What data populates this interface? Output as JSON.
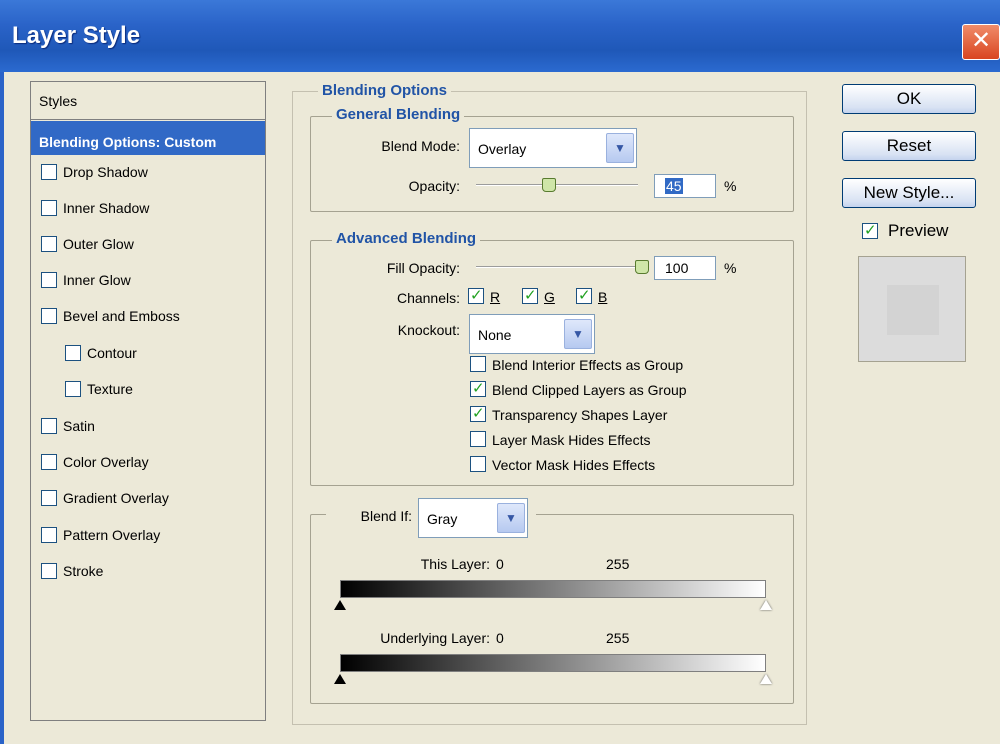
{
  "window": {
    "title": "Layer Style",
    "close_glyph": "✕"
  },
  "styles_panel": {
    "header": "Styles",
    "items": [
      {
        "label": "Blending Options: Custom",
        "selected": true,
        "checkbox": false
      },
      {
        "label": "Drop Shadow",
        "checked": false
      },
      {
        "label": "Inner Shadow",
        "checked": false
      },
      {
        "label": "Outer Glow",
        "checked": false
      },
      {
        "label": "Inner Glow",
        "checked": false
      },
      {
        "label": "Bevel and Emboss",
        "checked": false
      },
      {
        "label": "Contour",
        "checked": false,
        "indent": true
      },
      {
        "label": "Texture",
        "checked": false,
        "indent": true
      },
      {
        "label": "Satin",
        "checked": false
      },
      {
        "label": "Color Overlay",
        "checked": false
      },
      {
        "label": "Gradient Overlay",
        "checked": false
      },
      {
        "label": "Pattern Overlay",
        "checked": false
      },
      {
        "label": "Stroke",
        "checked": false
      }
    ]
  },
  "blending_options": {
    "title": "Blending Options",
    "general": {
      "title": "General Blending",
      "blend_mode_label": "Blend Mode:",
      "blend_mode_value": "Overlay",
      "opacity_label": "Opacity:",
      "opacity_value": "45",
      "opacity_unit": "%",
      "opacity_fraction": 0.45
    },
    "advanced": {
      "title": "Advanced Blending",
      "fill_opacity_label": "Fill Opacity:",
      "fill_opacity_value": "100",
      "fill_opacity_unit": "%",
      "fill_opacity_fraction": 1.0,
      "channels_label": "Channels:",
      "channels": [
        {
          "label": "R",
          "checked": true
        },
        {
          "label": "G",
          "checked": true
        },
        {
          "label": "B",
          "checked": true
        }
      ],
      "knockout_label": "Knockout:",
      "knockout_value": "None",
      "options": [
        {
          "label": "Blend Interior Effects as Group",
          "checked": false
        },
        {
          "label": "Blend Clipped Layers as Group",
          "checked": true
        },
        {
          "label": "Transparency Shapes Layer",
          "checked": true
        },
        {
          "label": "Layer Mask Hides Effects",
          "checked": false
        },
        {
          "label": "Vector Mask Hides Effects",
          "checked": false
        }
      ]
    },
    "blend_if": {
      "label": "Blend If:",
      "value": "Gray",
      "this_layer_label": "This Layer:",
      "this_layer_min": "0",
      "this_layer_max": "255",
      "underlying_label": "Underlying Layer:",
      "underlying_min": "0",
      "underlying_max": "255"
    }
  },
  "buttons": {
    "ok": "OK",
    "reset": "Reset",
    "new_style": "New Style...",
    "preview_label": "Preview",
    "preview_checked": true
  },
  "colors": {
    "title_bar": "#2a63c8",
    "selected_item": "#3169c6",
    "group_title": "#2154a6",
    "dialog_bg": "#ece9d8"
  },
  "icons": {
    "dropdown": "chevron-down-icon",
    "close": "close-icon",
    "checkmark": "check-icon"
  }
}
